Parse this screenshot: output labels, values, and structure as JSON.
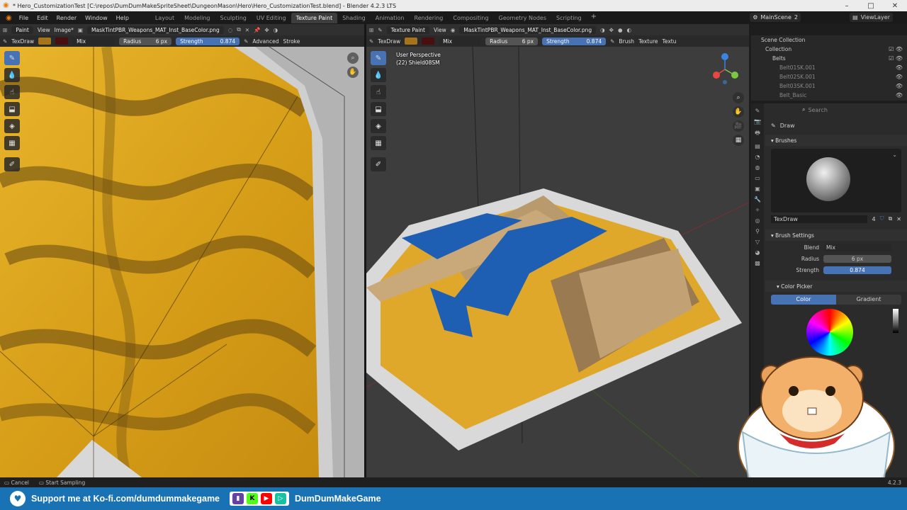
{
  "window": {
    "title": "* Hero_CustomizationTest [C:\\repos\\DumDumMakeSpriteSheet\\DungeonMason\\Hero\\Hero_CustomizationTest.blend] - Blender 4.2.3 LTS",
    "buttons": [
      "–",
      "□",
      "✕"
    ]
  },
  "menu": {
    "items": [
      "File",
      "Edit",
      "Render",
      "Window",
      "Help"
    ],
    "workspaces": [
      "Layout",
      "Modeling",
      "Sculpting",
      "UV Editing",
      "Texture Paint",
      "Shading",
      "Animation",
      "Rendering",
      "Compositing",
      "Geometry Nodes",
      "Scripting"
    ],
    "active_workspace": "Texture Paint",
    "scene": "MainScene",
    "scene_users": "2",
    "view_layer": "ViewLayer"
  },
  "left_editor": {
    "mode": "Paint",
    "view": "View",
    "image_menu": "Image*",
    "image_name": "MaskTintPBR_Weapons_MAT_Inst_BaseColor.png",
    "brush": "TexDraw",
    "blend": "Mix",
    "radius_label": "Radius",
    "radius_value": "6 px",
    "strength_label": "Strength",
    "strength_value": "0.874",
    "advanced": "Advanced",
    "stroke": "Stroke"
  },
  "right_editor": {
    "mode": "Texture Paint",
    "view": "View",
    "image_name": "MaskTintPBR_Weapons_MAT_Inst_BaseColor.png",
    "brush": "TexDraw",
    "blend": "Mix",
    "radius_label": "Radius",
    "radius_value": "6 px",
    "strength_label": "Strength",
    "strength_value": "0.874",
    "brush_menu": "Brush",
    "texture_menu": "Texture",
    "texture2_menu": "Textu",
    "overlay_line1": "User Perspective",
    "overlay_line2": "(22) Shield08SM"
  },
  "outliner": {
    "scene_collection": "Scene Collection",
    "collection": "Collection",
    "group": "Belts",
    "items": [
      "Belt01SK.001",
      "Belt02SK.001",
      "Belt03SK.001",
      "Belt_Basic"
    ]
  },
  "properties": {
    "search_placeholder": "Search",
    "tool_name": "Draw",
    "brushes_panel": "Brushes",
    "brush_name": "TexDraw",
    "brush_users": "4",
    "brush_settings_panel": "Brush Settings",
    "blend_label": "Blend",
    "blend_value": "Mix",
    "radius_label": "Radius",
    "radius_value": "6 px",
    "strength_label": "Strength",
    "strength_value": "0.874",
    "color_picker_panel": "Color Picker",
    "color_tab": "Color",
    "gradient_tab": "Gradient"
  },
  "status": {
    "cancel": "Cancel",
    "start_sampling": "Start Sampling",
    "version": "4.2.3"
  },
  "promo": {
    "support_text": "Support me at Ko-fi.com/dumdummakegame",
    "handle": "DumDumMakeGame"
  },
  "colors": {
    "accent_blue": "#4772b3",
    "primary_swatch": "#a8741a",
    "secondary_swatch": "#4a0e0e",
    "promo_bg": "#1872b3"
  }
}
